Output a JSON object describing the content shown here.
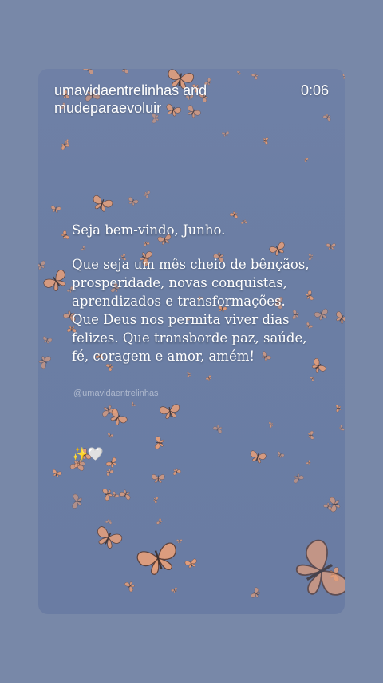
{
  "story": {
    "author_line": "umavidaentrelinhas and mudeparaevoluir",
    "elapsed": "0:06"
  },
  "post": {
    "greeting": "Seja bem-vindo, Junho.",
    "message": "Que seja um mês cheio de bênçãos, prosperidade, novas conquistas, aprendizados e transformações. Que Deus nos permita viver dias felizes. Que transborde paz, saúde, fé, coragem e amor, amém!",
    "watermark": "@umavidaentrelinhas",
    "emojis": "✨🤍"
  },
  "colors": {
    "page_bg": "#7888a8",
    "card_bg": "#6f80a6",
    "butterfly": "#e8a07a"
  }
}
